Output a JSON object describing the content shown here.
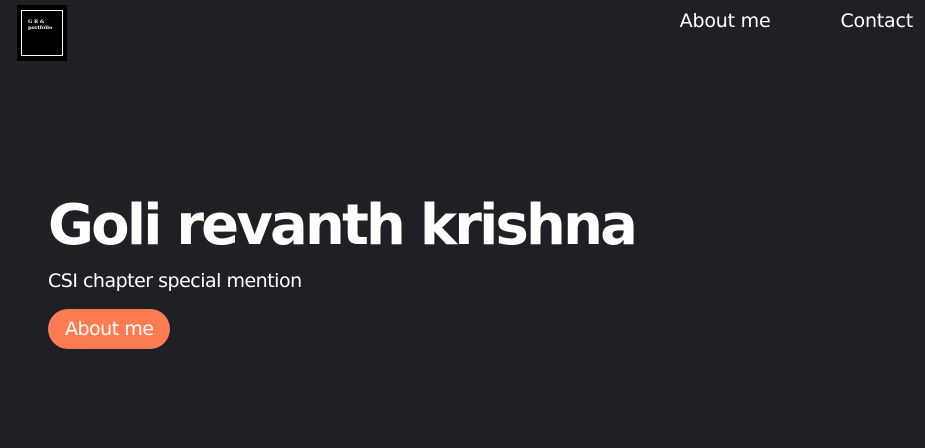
{
  "logo": {
    "line1": "G R &",
    "line2": "portfolio"
  },
  "nav": {
    "items": [
      {
        "label": "About me"
      },
      {
        "label": "Contact"
      }
    ]
  },
  "hero": {
    "title": "Goli revanth krishna",
    "subtitle": "CSI chapter special mention",
    "button_label": "About me"
  },
  "colors": {
    "background": "#1f1f26",
    "accent": "#ff7b52",
    "text": "#ffffff"
  }
}
